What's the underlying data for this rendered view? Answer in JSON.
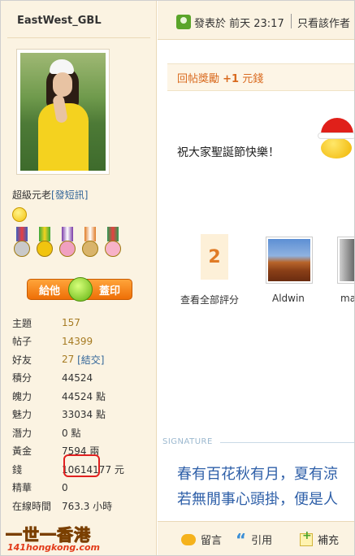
{
  "user": {
    "name": "EastWest_GBL",
    "rank": "超級元老",
    "rank_link": "[發短訊]"
  },
  "give_button": {
    "left": "給他",
    "right": "蓋印"
  },
  "stats": [
    {
      "key": "主題",
      "value": "157"
    },
    {
      "key": "帖子",
      "value": "14399"
    },
    {
      "key": "好友",
      "value": "27",
      "link": "[結交]"
    },
    {
      "key": "積分",
      "value": "44524"
    },
    {
      "key": "魄力",
      "value": "44524 點"
    },
    {
      "key": "魅力",
      "value": "33034 點"
    },
    {
      "key": "潛力",
      "value": "0 點"
    },
    {
      "key": "黃金",
      "value": "7594 兩"
    },
    {
      "key": "錢",
      "value": "10614177 元"
    },
    {
      "key": "精華",
      "value": "0"
    },
    {
      "key": "在線時間",
      "value": "763.3 小時"
    }
  ],
  "logo": {
    "big": "一世一香港",
    "small": "141hongkong.com"
  },
  "post": {
    "posted_label": "發表於 前天 23:17",
    "only_author": "只看該作者"
  },
  "reward": {
    "prefix": "回帖獎勵 ",
    "amount": "+1",
    "suffix": " 元錢"
  },
  "message": "祝大家聖誕節快樂！",
  "rating": {
    "count": "2",
    "view_all": "查看全部評分",
    "raters": [
      "Aldwin",
      "ma"
    ]
  },
  "signature": {
    "label": "SIGNATURE",
    "line1": "春有百花秋有月，夏有涼",
    "line2": "若無閒事心頭掛，便是人"
  },
  "actions": {
    "comment": "留言",
    "quote": "引用",
    "reply": "補充"
  },
  "colors": {
    "sidebar_bg": "#fbf3e2",
    "reward_text": "#d96a1f",
    "signature_text": "#2e5fa8",
    "link": "#336699"
  }
}
